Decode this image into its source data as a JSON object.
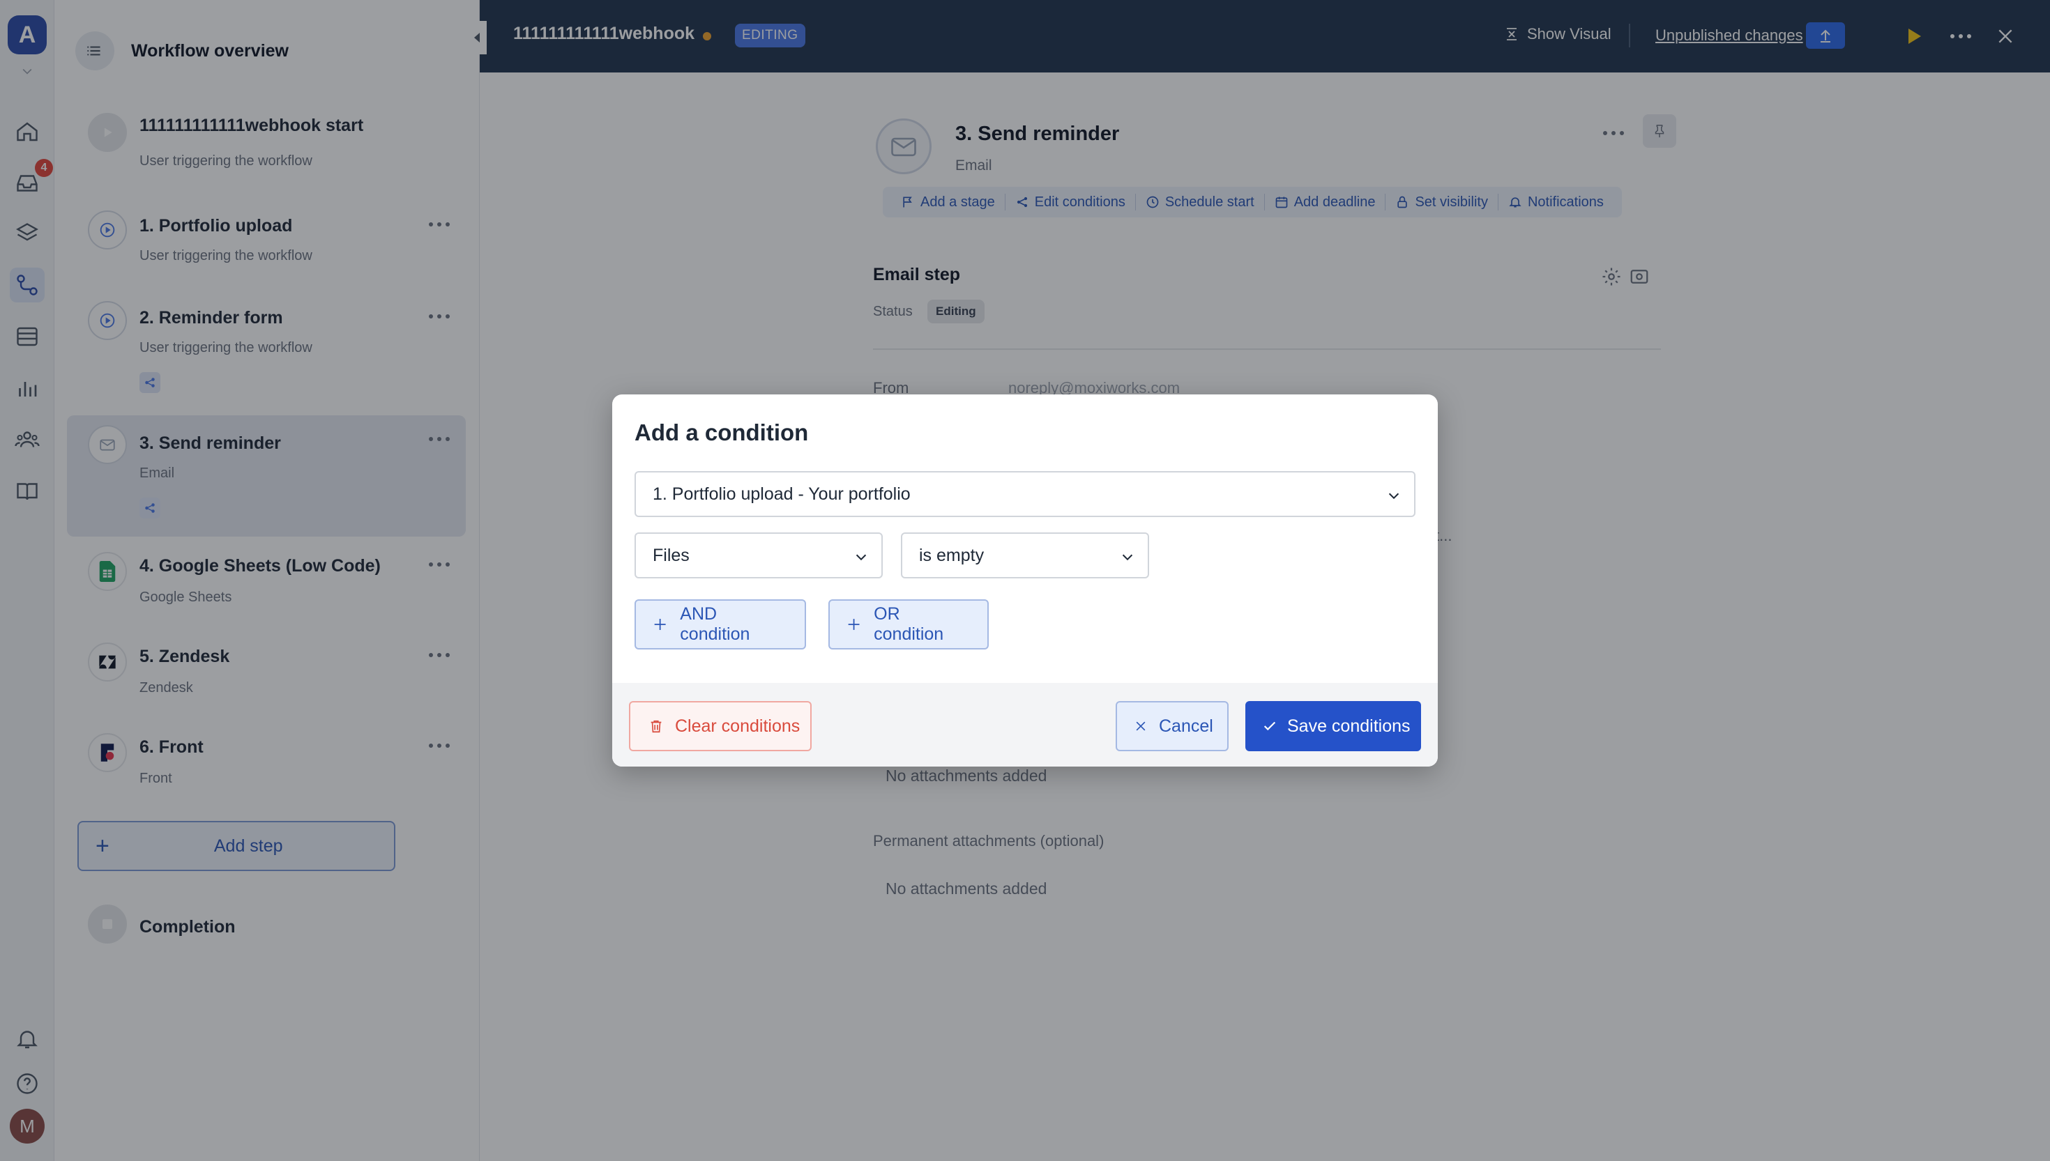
{
  "rail": {
    "logo": "A",
    "inbox_badge": "4",
    "avatar_initial": "M",
    "items": [
      "home-icon",
      "inbox-icon",
      "layers-icon",
      "workflow-icon",
      "table-icon",
      "chart-icon",
      "users-icon",
      "book-icon"
    ],
    "bottom": [
      "bell-icon",
      "help-icon"
    ]
  },
  "sidebar": {
    "overview": "Workflow overview",
    "steps": [
      {
        "title": "111111111111webhook start",
        "subtitle": "User triggering the workflow",
        "icon": "play-icon"
      },
      {
        "title": "1. Portfolio upload",
        "subtitle": "User triggering the workflow",
        "icon": "form-icon"
      },
      {
        "title": "2. Reminder form",
        "subtitle": "User triggering the workflow",
        "icon": "form-icon"
      },
      {
        "title": "3. Send reminder",
        "subtitle": "Email",
        "icon": "mail-icon"
      },
      {
        "title": "4. Google Sheets (Low Code)",
        "subtitle": "Google Sheets",
        "icon": "google-sheets-icon"
      },
      {
        "title": "5. Zendesk",
        "subtitle": "Zendesk",
        "icon": "zendesk-icon"
      },
      {
        "title": "6. Front",
        "subtitle": "Front",
        "icon": "front-icon"
      }
    ],
    "add_step": "Add step",
    "completion": "Completion"
  },
  "topbar": {
    "workflow_name": "111111111111webhook",
    "status": "EDITING",
    "show_visual": "Show Visual",
    "unpublished": "Unpublished changes"
  },
  "main": {
    "title": "3. Send reminder",
    "subtitle": "Email",
    "actions": [
      "Add a stage",
      "Edit conditions",
      "Schedule start",
      "Add deadline",
      "Set visibility",
      "Notifications"
    ],
    "section_title": "Email step",
    "status_label": "Status",
    "status_value": "Editing",
    "from_label": "From",
    "from_value": "noreply@moxiworks.com",
    "truncated_text": "t...",
    "no_attachments_1": "No attachments added",
    "permanent_label": "Permanent attachments (optional)",
    "no_attachments_2": "No attachments added"
  },
  "modal": {
    "title": "Add a condition",
    "source_value": "1. Portfolio upload - Your portfolio",
    "field_value": "Files",
    "operator_value": "is empty",
    "and_button": "AND condition",
    "or_button": "OR condition",
    "clear_button": "Clear conditions",
    "cancel_button": "Cancel",
    "save_button": "Save conditions"
  },
  "colors": {
    "brand": "#2b4ba8",
    "topbar": "#22354f",
    "primary_button": "#2552c9",
    "danger": "#d94b3d",
    "status_dot": "#f0a32e"
  }
}
